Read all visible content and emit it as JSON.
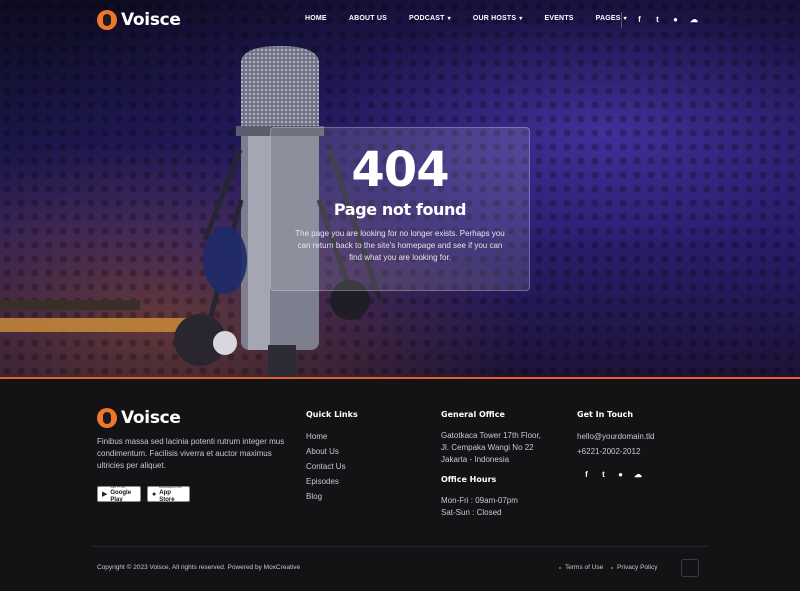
{
  "brand": {
    "name": "Voisce"
  },
  "nav": {
    "items": [
      {
        "label": "HOME",
        "dropdown": false
      },
      {
        "label": "ABOUT US",
        "dropdown": false
      },
      {
        "label": "PODCAST",
        "dropdown": true
      },
      {
        "label": "OUR HOSTS",
        "dropdown": true
      },
      {
        "label": "EVENTS",
        "dropdown": false
      },
      {
        "label": "PAGES",
        "dropdown": true
      }
    ],
    "social": [
      "f",
      "t",
      "●",
      "☁"
    ]
  },
  "error": {
    "code": "404",
    "title": "Page not found",
    "description": "The page you are looking for no longer exists. Perhaps you can return back to the site's homepage and see if you can find what you are looking for."
  },
  "footer": {
    "about": "Finibus massa sed lacinia potenti rutrum integer mus condimentum. Facilisis viverra et auctor maximus ultricies per aliquet.",
    "badges": {
      "google": {
        "small": "GET IT ON",
        "label": "Google Play"
      },
      "apple": {
        "small": "Download on the",
        "label": "App Store"
      }
    },
    "quick_links": {
      "title": "Quick Links",
      "items": [
        "Home",
        "About Us",
        "Contact Us",
        "Episodes",
        "Blog"
      ]
    },
    "office": {
      "title": "General Office",
      "address": [
        "Gatotkaca Tower 17th Floor,",
        "Jl. Cempaka Wangi No 22",
        "Jakarta - Indonesia"
      ],
      "hours_title": "Office Hours",
      "hours": [
        "Mon-Fri : 09am-07pm",
        "Sat-Sun : Closed"
      ]
    },
    "contact": {
      "title": "Get In Touch",
      "email": "hello@yourdomain.tld",
      "phone": "+6221-2002-2012"
    },
    "social": [
      "f",
      "t",
      "●",
      "☁"
    ],
    "copyright": "Copyright © 2023 Voisce, All rights reserved. Powered by MoxCreative",
    "legal": [
      "Terms of Use",
      "Privacy Policy"
    ]
  },
  "colors": {
    "accent": "#e2622a",
    "footer_bg": "#131315"
  }
}
